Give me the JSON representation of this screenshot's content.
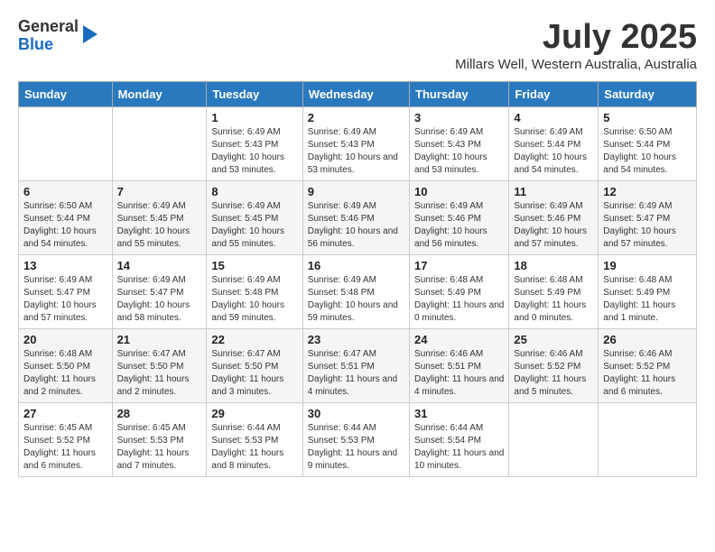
{
  "logo": {
    "general": "General",
    "blue": "Blue"
  },
  "title": "July 2025",
  "subtitle": "Millars Well, Western Australia, Australia",
  "days_of_week": [
    "Sunday",
    "Monday",
    "Tuesday",
    "Wednesday",
    "Thursday",
    "Friday",
    "Saturday"
  ],
  "weeks": [
    [
      {
        "day": "",
        "sunrise": "",
        "sunset": "",
        "daylight": ""
      },
      {
        "day": "",
        "sunrise": "",
        "sunset": "",
        "daylight": ""
      },
      {
        "day": "1",
        "sunrise": "Sunrise: 6:49 AM",
        "sunset": "Sunset: 5:43 PM",
        "daylight": "Daylight: 10 hours and 53 minutes."
      },
      {
        "day": "2",
        "sunrise": "Sunrise: 6:49 AM",
        "sunset": "Sunset: 5:43 PM",
        "daylight": "Daylight: 10 hours and 53 minutes."
      },
      {
        "day": "3",
        "sunrise": "Sunrise: 6:49 AM",
        "sunset": "Sunset: 5:43 PM",
        "daylight": "Daylight: 10 hours and 53 minutes."
      },
      {
        "day": "4",
        "sunrise": "Sunrise: 6:49 AM",
        "sunset": "Sunset: 5:44 PM",
        "daylight": "Daylight: 10 hours and 54 minutes."
      },
      {
        "day": "5",
        "sunrise": "Sunrise: 6:50 AM",
        "sunset": "Sunset: 5:44 PM",
        "daylight": "Daylight: 10 hours and 54 minutes."
      }
    ],
    [
      {
        "day": "6",
        "sunrise": "Sunrise: 6:50 AM",
        "sunset": "Sunset: 5:44 PM",
        "daylight": "Daylight: 10 hours and 54 minutes."
      },
      {
        "day": "7",
        "sunrise": "Sunrise: 6:49 AM",
        "sunset": "Sunset: 5:45 PM",
        "daylight": "Daylight: 10 hours and 55 minutes."
      },
      {
        "day": "8",
        "sunrise": "Sunrise: 6:49 AM",
        "sunset": "Sunset: 5:45 PM",
        "daylight": "Daylight: 10 hours and 55 minutes."
      },
      {
        "day": "9",
        "sunrise": "Sunrise: 6:49 AM",
        "sunset": "Sunset: 5:46 PM",
        "daylight": "Daylight: 10 hours and 56 minutes."
      },
      {
        "day": "10",
        "sunrise": "Sunrise: 6:49 AM",
        "sunset": "Sunset: 5:46 PM",
        "daylight": "Daylight: 10 hours and 56 minutes."
      },
      {
        "day": "11",
        "sunrise": "Sunrise: 6:49 AM",
        "sunset": "Sunset: 5:46 PM",
        "daylight": "Daylight: 10 hours and 57 minutes."
      },
      {
        "day": "12",
        "sunrise": "Sunrise: 6:49 AM",
        "sunset": "Sunset: 5:47 PM",
        "daylight": "Daylight: 10 hours and 57 minutes."
      }
    ],
    [
      {
        "day": "13",
        "sunrise": "Sunrise: 6:49 AM",
        "sunset": "Sunset: 5:47 PM",
        "daylight": "Daylight: 10 hours and 57 minutes."
      },
      {
        "day": "14",
        "sunrise": "Sunrise: 6:49 AM",
        "sunset": "Sunset: 5:47 PM",
        "daylight": "Daylight: 10 hours and 58 minutes."
      },
      {
        "day": "15",
        "sunrise": "Sunrise: 6:49 AM",
        "sunset": "Sunset: 5:48 PM",
        "daylight": "Daylight: 10 hours and 59 minutes."
      },
      {
        "day": "16",
        "sunrise": "Sunrise: 6:49 AM",
        "sunset": "Sunset: 5:48 PM",
        "daylight": "Daylight: 10 hours and 59 minutes."
      },
      {
        "day": "17",
        "sunrise": "Sunrise: 6:48 AM",
        "sunset": "Sunset: 5:49 PM",
        "daylight": "Daylight: 11 hours and 0 minutes."
      },
      {
        "day": "18",
        "sunrise": "Sunrise: 6:48 AM",
        "sunset": "Sunset: 5:49 PM",
        "daylight": "Daylight: 11 hours and 0 minutes."
      },
      {
        "day": "19",
        "sunrise": "Sunrise: 6:48 AM",
        "sunset": "Sunset: 5:49 PM",
        "daylight": "Daylight: 11 hours and 1 minute."
      }
    ],
    [
      {
        "day": "20",
        "sunrise": "Sunrise: 6:48 AM",
        "sunset": "Sunset: 5:50 PM",
        "daylight": "Daylight: 11 hours and 2 minutes."
      },
      {
        "day": "21",
        "sunrise": "Sunrise: 6:47 AM",
        "sunset": "Sunset: 5:50 PM",
        "daylight": "Daylight: 11 hours and 2 minutes."
      },
      {
        "day": "22",
        "sunrise": "Sunrise: 6:47 AM",
        "sunset": "Sunset: 5:50 PM",
        "daylight": "Daylight: 11 hours and 3 minutes."
      },
      {
        "day": "23",
        "sunrise": "Sunrise: 6:47 AM",
        "sunset": "Sunset: 5:51 PM",
        "daylight": "Daylight: 11 hours and 4 minutes."
      },
      {
        "day": "24",
        "sunrise": "Sunrise: 6:46 AM",
        "sunset": "Sunset: 5:51 PM",
        "daylight": "Daylight: 11 hours and 4 minutes."
      },
      {
        "day": "25",
        "sunrise": "Sunrise: 6:46 AM",
        "sunset": "Sunset: 5:52 PM",
        "daylight": "Daylight: 11 hours and 5 minutes."
      },
      {
        "day": "26",
        "sunrise": "Sunrise: 6:46 AM",
        "sunset": "Sunset: 5:52 PM",
        "daylight": "Daylight: 11 hours and 6 minutes."
      }
    ],
    [
      {
        "day": "27",
        "sunrise": "Sunrise: 6:45 AM",
        "sunset": "Sunset: 5:52 PM",
        "daylight": "Daylight: 11 hours and 6 minutes."
      },
      {
        "day": "28",
        "sunrise": "Sunrise: 6:45 AM",
        "sunset": "Sunset: 5:53 PM",
        "daylight": "Daylight: 11 hours and 7 minutes."
      },
      {
        "day": "29",
        "sunrise": "Sunrise: 6:44 AM",
        "sunset": "Sunset: 5:53 PM",
        "daylight": "Daylight: 11 hours and 8 minutes."
      },
      {
        "day": "30",
        "sunrise": "Sunrise: 6:44 AM",
        "sunset": "Sunset: 5:53 PM",
        "daylight": "Daylight: 11 hours and 9 minutes."
      },
      {
        "day": "31",
        "sunrise": "Sunrise: 6:44 AM",
        "sunset": "Sunset: 5:54 PM",
        "daylight": "Daylight: 11 hours and 10 minutes."
      },
      {
        "day": "",
        "sunrise": "",
        "sunset": "",
        "daylight": ""
      },
      {
        "day": "",
        "sunrise": "",
        "sunset": "",
        "daylight": ""
      }
    ]
  ]
}
